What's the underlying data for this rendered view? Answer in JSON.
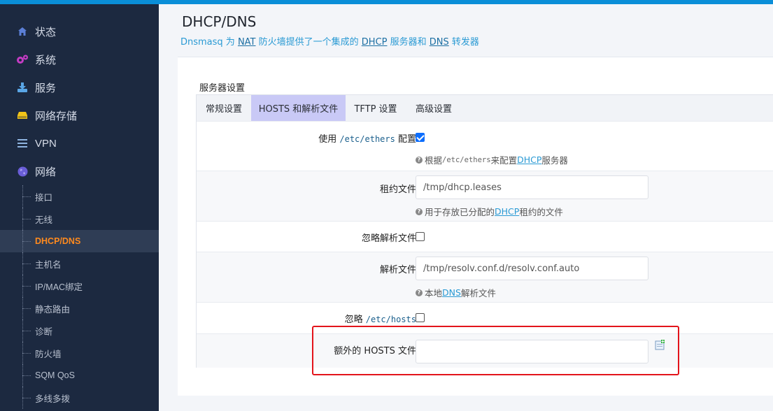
{
  "sidebar": {
    "items": [
      {
        "label": "状态",
        "icon": "home-icon"
      },
      {
        "label": "系统",
        "icon": "gears-icon"
      },
      {
        "label": "服务",
        "icon": "download-icon"
      },
      {
        "label": "网络存储",
        "icon": "storage-icon"
      },
      {
        "label": "VPN",
        "icon": "list-icon"
      },
      {
        "label": "网络",
        "icon": "globe-icon"
      }
    ],
    "network_sub": [
      {
        "label": "接口"
      },
      {
        "label": "无线"
      },
      {
        "label": "DHCP/DNS",
        "active": true
      },
      {
        "label": "主机名"
      },
      {
        "label": "IP/MAC绑定"
      },
      {
        "label": "静态路由"
      },
      {
        "label": "诊断"
      },
      {
        "label": "防火墙"
      },
      {
        "label": "SQM QoS"
      },
      {
        "label": "多线多拨"
      }
    ]
  },
  "page": {
    "title": "DHCP/DNS",
    "desc_1": "Dnsmasq 为 ",
    "desc_nat": "NAT",
    "desc_2": " 防火墙提供了一个集成的 ",
    "desc_dhcp": "DHCP",
    "desc_3": " 服务器和 ",
    "desc_dns": "DNS",
    "desc_4": " 转发器"
  },
  "section": {
    "title": "服务器设置",
    "tabs": [
      "常规设置",
      "HOSTS 和解析文件",
      "TFTP 设置",
      "高级设置"
    ],
    "active_tab": 1
  },
  "form": {
    "use_ethers": {
      "label_1": "使用 ",
      "label_code": "/etc/ethers",
      "label_2": " 配置",
      "checked": true,
      "help_1": "根据 ",
      "help_code": "/etc/ethers",
      "help_2": " 来配置 ",
      "help_link": "DHCP",
      "help_3": " 服务器"
    },
    "leasefile": {
      "label": "租约文件",
      "value": "/tmp/dhcp.leases",
      "help_1": "用于存放已分配的 ",
      "help_link": "DHCP",
      "help_2": " 租约的文件"
    },
    "noresolv": {
      "label": "忽略解析文件",
      "checked": false
    },
    "resolvfile": {
      "label": "解析文件",
      "value": "/tmp/resolv.conf.d/resolv.conf.auto",
      "help_1": "本地 ",
      "help_link": "DNS",
      "help_2": " 解析文件"
    },
    "nohosts": {
      "label_1": "忽略 ",
      "label_code": "/etc/hosts",
      "checked": false
    },
    "addnhosts": {
      "label": "额外的 HOSTS 文件",
      "value": "",
      "add_icon": "add-entry-icon"
    }
  },
  "colors": {
    "accent": "#0a8ed8",
    "sidebar_bg": "#1c2940",
    "active_menu": "#ff8a1e",
    "active_tab": "#c9c9f6",
    "highlight": "#e3141b"
  }
}
